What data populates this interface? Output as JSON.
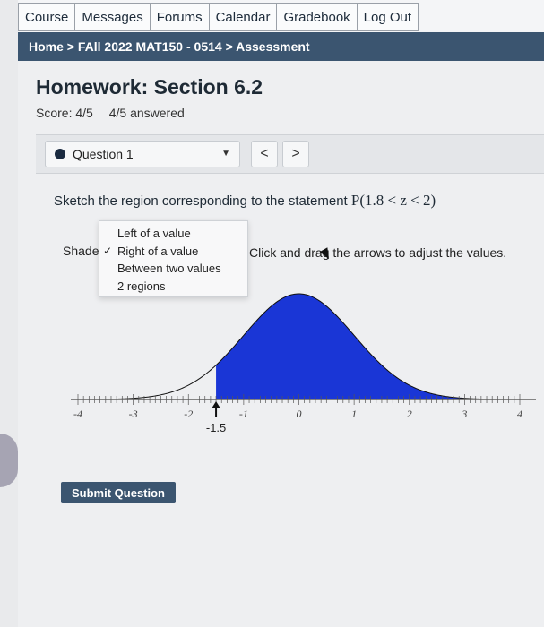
{
  "nav": {
    "tabs": [
      "Course",
      "Messages",
      "Forums",
      "Calendar",
      "Gradebook",
      "Log Out"
    ]
  },
  "breadcrumb": "Home > FAll 2022 MAT150 - 0514 > Assessment",
  "page": {
    "title": "Homework: Section 6.2",
    "score": "Score: 4/5",
    "answered": "4/5 answered"
  },
  "question_nav": {
    "selected": "Question 1",
    "prev": "<",
    "next": ">"
  },
  "question": {
    "prompt": "Sketch the region corresponding to the statement",
    "statement": "P(1.8 < z < 2)"
  },
  "shade": {
    "label": "Shade",
    "options": [
      "Left of a value",
      "Right of a value",
      "Between two values",
      "2 regions"
    ],
    "selected_index": 1,
    "instruction": "Click and drag the arrows to adjust the values."
  },
  "chart_data": {
    "type": "area",
    "curve": "standard normal",
    "x_ticks": [
      "-4",
      "-3",
      "-2",
      "-1",
      "0",
      "1",
      "2",
      "3",
      "4"
    ],
    "xlim": [
      -4,
      4
    ],
    "shaded_from": -1.5,
    "shaded_to": 4,
    "marker_label": "-1.5",
    "colors": {
      "fill": "#1a36d6",
      "curve": "#111111"
    }
  },
  "submit": {
    "label": "Submit Question"
  },
  "colors": {
    "header": "#3b5570",
    "accent": "#1a36d6"
  }
}
